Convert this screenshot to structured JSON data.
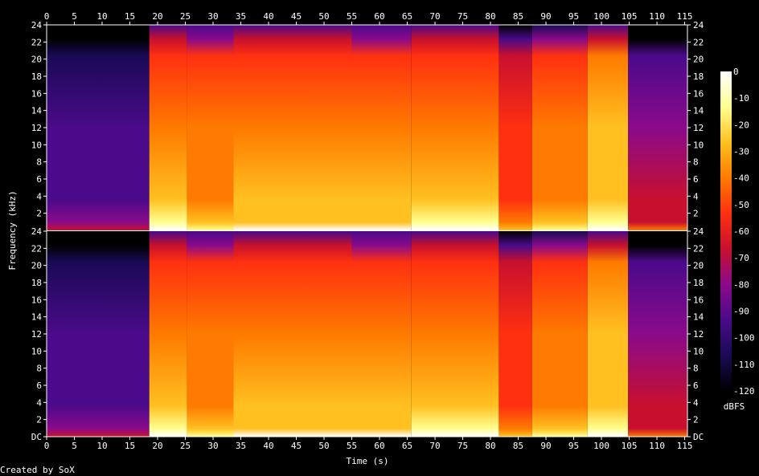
{
  "chart_data": {
    "type": "heatmap",
    "title": "",
    "xlabel": "Time (s)",
    "ylabel": "Frequency (kHz)",
    "xlim": [
      0,
      115.5
    ],
    "ylim_khz": [
      0,
      24
    ],
    "x_ticks": [
      "0",
      "5",
      "10",
      "15",
      "20",
      "25",
      "30",
      "35",
      "40",
      "45",
      "50",
      "55",
      "60",
      "65",
      "70",
      "75",
      "80",
      "85",
      "90",
      "95",
      "100",
      "105",
      "110",
      "115"
    ],
    "y_ticks": [
      "DC",
      "2",
      "4",
      "6",
      "8",
      "10",
      "12",
      "14",
      "16",
      "18",
      "20",
      "22",
      "24"
    ],
    "channels": [
      "upper",
      "lower"
    ],
    "colorbar": {
      "label": "dBFS",
      "ticks": [
        "0",
        "-10",
        "-20",
        "-30",
        "-40",
        "-50",
        "-60",
        "-70",
        "-80",
        "-90",
        "-100",
        "-110",
        "-120"
      ],
      "range": [
        -120,
        0
      ],
      "colors": [
        "#000000",
        "#1a0a55",
        "#4a0a8a",
        "#8a0a8a",
        "#c8102e",
        "#ff3010",
        "#ff7a00",
        "#ffc020",
        "#ffff90",
        "#ffffff"
      ]
    },
    "segments": [
      {
        "t0": 0,
        "t1": 18.5,
        "intensity": 0.25
      },
      {
        "t0": 18.5,
        "t1": 25.3,
        "intensity": 0.78
      },
      {
        "t0": 25.3,
        "t1": 33.7,
        "intensity": 0.72
      },
      {
        "t0": 33.7,
        "t1": 40.8,
        "intensity": 0.75
      },
      {
        "t0": 40.8,
        "t1": 55.0,
        "intensity": 0.74
      },
      {
        "t0": 55.0,
        "t1": 65.7,
        "intensity": 0.73
      },
      {
        "t0": 65.7,
        "t1": 81.5,
        "intensity": 0.78
      },
      {
        "t0": 81.5,
        "t1": 87.5,
        "intensity": 0.6
      },
      {
        "t0": 87.5,
        "t1": 97.5,
        "intensity": 0.7
      },
      {
        "t0": 97.5,
        "t1": 104.8,
        "intensity": 0.82
      },
      {
        "t0": 104.8,
        "t1": 115.5,
        "intensity": 0.4
      }
    ]
  },
  "footer": {
    "credit": "Created by SoX"
  }
}
